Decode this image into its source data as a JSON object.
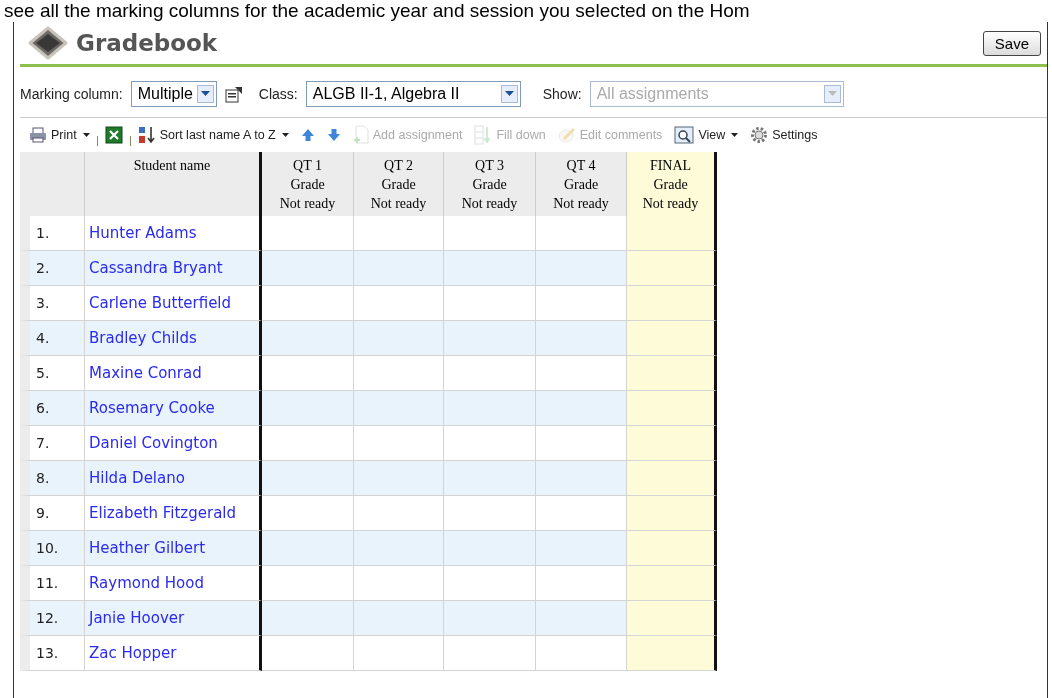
{
  "caption": "see all the marking columns for the academic year and session you selected on the Hom",
  "title": "Gradebook",
  "save_button": "Save",
  "filters": {
    "marking_column": {
      "label": "Marking column:",
      "value": "Multiple"
    },
    "class": {
      "label": "Class:",
      "value": "ALGB II-1, Algebra II"
    },
    "show": {
      "label": "Show:",
      "placeholder": "All assignments",
      "disabled": true
    }
  },
  "toolbar": [
    {
      "kind": "print",
      "label": "Print",
      "dropdown": true,
      "disabled": false
    },
    {
      "kind": "excel",
      "dropdown": false,
      "disabled": false
    },
    {
      "kind": "sort",
      "label": "Sort last name A to Z",
      "dropdown": true,
      "disabled": false
    },
    {
      "kind": "up",
      "dropdown": false,
      "disabled": false
    },
    {
      "kind": "down",
      "dropdown": false,
      "disabled": false
    },
    {
      "kind": "add",
      "label": "Add assignment",
      "dropdown": false,
      "disabled": true
    },
    {
      "kind": "fill",
      "label": "Fill down",
      "dropdown": false,
      "disabled": true
    },
    {
      "kind": "edit",
      "label": "Edit comments",
      "dropdown": false,
      "disabled": true
    },
    {
      "kind": "view",
      "label": "View",
      "dropdown": true,
      "disabled": false
    },
    {
      "kind": "settings",
      "label": "Settings",
      "dropdown": false,
      "disabled": false
    }
  ],
  "table": {
    "columns": [
      {
        "kind": "name",
        "lines": [
          "Student name"
        ]
      },
      {
        "kind": "quarter",
        "lines": [
          "QT 1",
          "Grade",
          "Not ready"
        ]
      },
      {
        "kind": "quarter",
        "lines": [
          "QT 2",
          "Grade",
          "Not ready"
        ]
      },
      {
        "kind": "quarter",
        "lines": [
          "QT 3",
          "Grade",
          "Not ready"
        ]
      },
      {
        "kind": "quarter",
        "lines": [
          "QT 4",
          "Grade",
          "Not ready"
        ]
      },
      {
        "kind": "final",
        "lines": [
          "FINAL",
          "Grade",
          "Not ready"
        ]
      }
    ],
    "rows": [
      {
        "number": "1.",
        "name": "Hunter Adams"
      },
      {
        "number": "2.",
        "name": "Cassandra Bryant"
      },
      {
        "number": "3.",
        "name": "Carlene Butterfield"
      },
      {
        "number": "4.",
        "name": "Bradley Childs"
      },
      {
        "number": "5.",
        "name": "Maxine Conrad"
      },
      {
        "number": "6.",
        "name": "Rosemary Cooke"
      },
      {
        "number": "7.",
        "name": "Daniel Covington"
      },
      {
        "number": "8.",
        "name": "Hilda Delano"
      },
      {
        "number": "9.",
        "name": "Elizabeth Fitzgerald"
      },
      {
        "number": "10.",
        "name": "Heather Gilbert"
      },
      {
        "number": "11.",
        "name": "Raymond Hood"
      },
      {
        "number": "12.",
        "name": "Janie Hoover"
      },
      {
        "number": "13.",
        "name": "Zac Hopper"
      }
    ]
  }
}
